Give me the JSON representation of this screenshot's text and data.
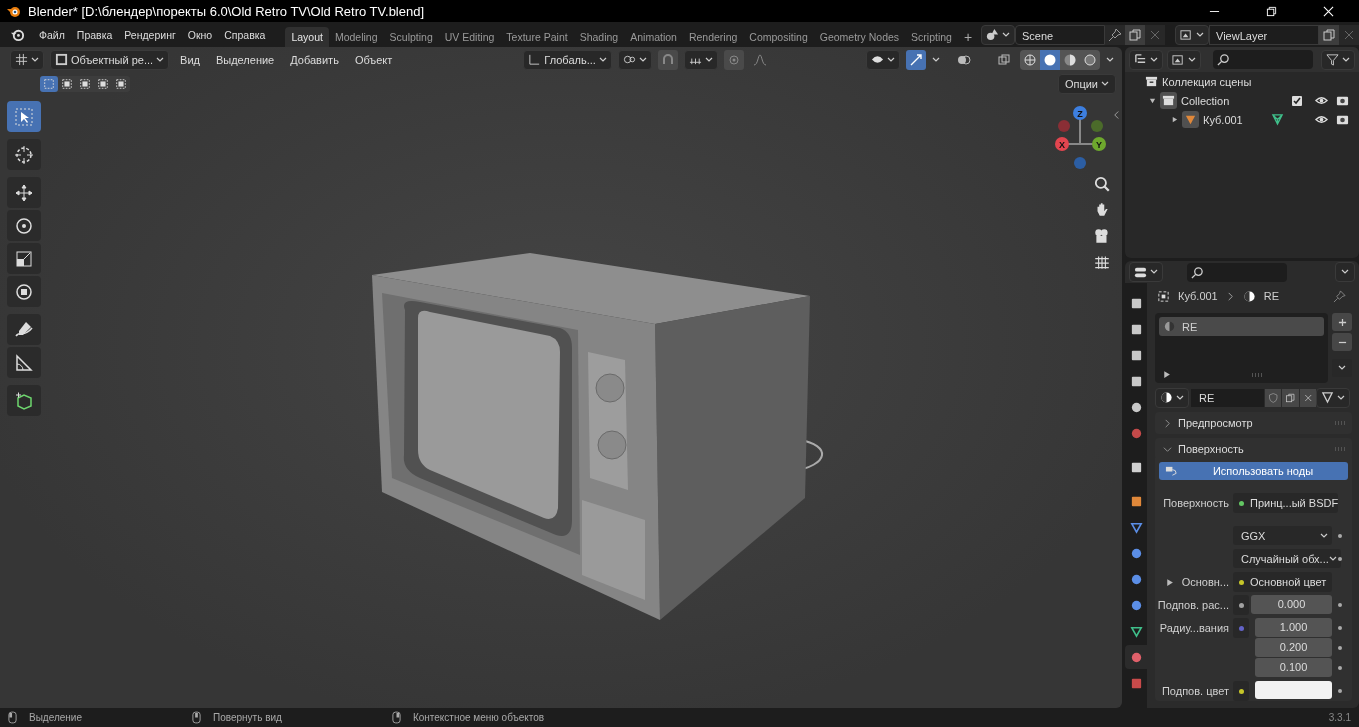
{
  "window": {
    "title": "Blender* [D:\\блендер\\поректы 6.0\\Old Retro TV\\Old Retro TV.blend]"
  },
  "menu": [
    "Файл",
    "Правка",
    "Рендеринг",
    "Окно",
    "Справка"
  ],
  "workspaces": [
    {
      "label": "Layout",
      "selected": true
    },
    {
      "label": "Modeling",
      "selected": false
    },
    {
      "label": "Sculpting",
      "selected": false
    },
    {
      "label": "UV Editing",
      "selected": false
    },
    {
      "label": "Texture Paint",
      "selected": false
    },
    {
      "label": "Shading",
      "selected": false
    },
    {
      "label": "Animation",
      "selected": false
    },
    {
      "label": "Rendering",
      "selected": false
    },
    {
      "label": "Compositing",
      "selected": false
    },
    {
      "label": "Geometry Nodes",
      "selected": false
    },
    {
      "label": "Scripting",
      "selected": false
    }
  ],
  "add_workspace": "+",
  "scene": "Scene",
  "view_layer": "ViewLayer",
  "viewport": {
    "mode": "Объектный ре...",
    "menus": [
      "Вид",
      "Выделение",
      "Добавить",
      "Объект"
    ],
    "orientation": "Глобаль...",
    "options": "Опции",
    "selection_modes": [
      {
        "selected": true
      },
      {
        "selected": false
      },
      {
        "selected": false
      },
      {
        "selected": false
      },
      {
        "selected": false
      }
    ],
    "shading": [
      {
        "kind": "wireframe",
        "selected": false
      },
      {
        "kind": "solid",
        "selected": true
      },
      {
        "kind": "material",
        "selected": false
      },
      {
        "kind": "rendered",
        "selected": false
      }
    ],
    "tools": [
      {
        "kind": "select",
        "selected": true
      },
      {
        "kind": "cursor",
        "selected": false
      },
      {
        "kind": "move",
        "selected": false
      },
      {
        "kind": "rotate",
        "selected": false
      },
      {
        "kind": "scale",
        "selected": false
      },
      {
        "kind": "transform",
        "selected": false
      },
      {
        "kind": "annotate",
        "selected": false
      },
      {
        "kind": "measure",
        "selected": false
      },
      {
        "kind": "add-cube",
        "selected": false
      }
    ],
    "gizmo": {
      "x": "X",
      "y": "Y",
      "z": "Z"
    }
  },
  "outliner": {
    "tree": [
      {
        "label": "Коллекция сцены",
        "children": [
          {
            "label": "Collection",
            "expanded": true,
            "checked": true,
            "children": [
              {
                "label": "Куб.001",
                "expanded": false
              }
            ]
          }
        ]
      }
    ]
  },
  "properties": {
    "tabs": [
      {
        "kind": "tool",
        "selected": false
      },
      {
        "kind": "render",
        "selected": false
      },
      {
        "kind": "output",
        "selected": false
      },
      {
        "kind": "view-layer",
        "selected": false
      },
      {
        "kind": "scene",
        "selected": false
      },
      {
        "kind": "world",
        "selected": false
      },
      {
        "kind": "collection",
        "selected": false
      },
      {
        "kind": "object",
        "selected": false
      },
      {
        "kind": "modifier",
        "selected": false
      },
      {
        "kind": "particles",
        "selected": false
      },
      {
        "kind": "physics",
        "selected": false
      },
      {
        "kind": "constraints",
        "selected": false
      },
      {
        "kind": "data",
        "selected": false
      },
      {
        "kind": "material",
        "selected": true
      },
      {
        "kind": "texture",
        "selected": false
      }
    ],
    "breadcrumb": [
      "Куб.001",
      "RE"
    ],
    "slots": [
      {
        "name": "RE",
        "selected": true
      }
    ],
    "material": "RE",
    "panels": [
      {
        "title": "Предпросмотр",
        "expanded": false
      },
      {
        "title": "Поверхность",
        "expanded": true
      }
    ],
    "use_nodes": "Использовать ноды",
    "rows": [
      {
        "kind": "shader",
        "label": "Поверхность",
        "color": "#63c763",
        "value": "Принц...ый BSDF"
      },
      {
        "kind": "enum",
        "value": "GGX"
      },
      {
        "kind": "enum",
        "value": "Случайный обх..."
      },
      {
        "kind": "link",
        "label": "Основн...",
        "expanded": false,
        "color": "#c7c729",
        "value": "Основной цвет"
      },
      {
        "kind": "value",
        "label": "Подпов. рас...",
        "color": "#a1a1a1",
        "value": "0.000"
      },
      {
        "kind": "vector",
        "label": "Радиу...вания",
        "color": "#6363c7",
        "values": [
          "1.000",
          "0.200",
          "0.100"
        ]
      },
      {
        "kind": "color",
        "label": "Подпов. цвет",
        "color": "#c7c729"
      }
    ]
  },
  "status_bar": {
    "hints": [
      "Выделение",
      "Повернуть вид",
      "Контекстное меню объектов"
    ],
    "version": "3.3.1"
  }
}
